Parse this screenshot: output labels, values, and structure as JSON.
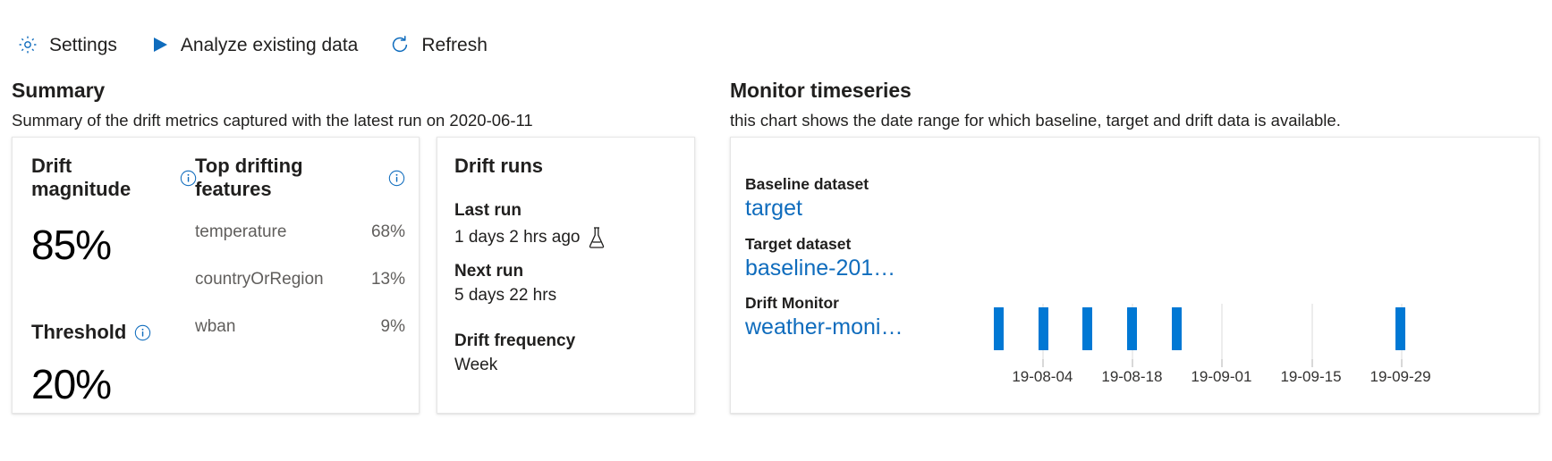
{
  "commandbar": {
    "buttons": [
      {
        "label": "Settings",
        "icon": "gear-icon"
      },
      {
        "label": "Analyze existing data",
        "icon": "play-icon"
      },
      {
        "label": "Refresh",
        "icon": "refresh-icon"
      }
    ]
  },
  "summary": {
    "title": "Summary",
    "subtitle": "Summary of the drift metrics captured with the latest run on 2020-06-11",
    "drift_magnitude": {
      "label": "Drift magnitude",
      "value": "85%",
      "info_icon": "info-icon"
    },
    "threshold": {
      "label": "Threshold",
      "value": "20%",
      "info_icon": "info-icon"
    },
    "top_drifting_features": {
      "label": "Top drifting features",
      "info_icon": "info-icon",
      "rows": [
        {
          "name": "temperature",
          "value": "68%"
        },
        {
          "name": "countryOrRegion",
          "value": "13%"
        },
        {
          "name": "wban",
          "value": "9%"
        }
      ]
    }
  },
  "drift_runs": {
    "title": "Drift runs",
    "last_run_label": "Last run",
    "last_run_value": "1 days 2 hrs ago",
    "last_run_icon": "flask-icon",
    "next_run_label": "Next run",
    "next_run_value": "5 days 22 hrs",
    "frequency_label": "Drift frequency",
    "frequency_value": "Week"
  },
  "monitor_timeseries": {
    "title": "Monitor timeseries",
    "subtitle": "this chart shows the date range for which baseline, target and drift data is available.",
    "baseline_label": "Baseline dataset",
    "baseline_link": "target",
    "target_label": "Target dataset",
    "target_link": "baseline-201…",
    "monitor_label": "Drift Monitor",
    "monitor_link": "weather-moni…",
    "link_color": "#0f6cbd",
    "bar_color": "#0078d4"
  },
  "chart_data": {
    "type": "bar",
    "title": "Monitor timeseries",
    "xlabel": "",
    "ylabel": "",
    "grid": true,
    "legend": false,
    "tick_labels": [
      "19-08-04",
      "19-08-18",
      "19-09-01",
      "19-09-15",
      "19-09-29"
    ],
    "tick_positions_pct": [
      21.5,
      36.0,
      50.5,
      65.0,
      79.5
    ],
    "series": [
      {
        "name": "Drift Monitor",
        "color": "#0078d4",
        "points": [
          {
            "x": "19-07-28",
            "x_pct": 14.4,
            "value": 1
          },
          {
            "x": "19-08-04",
            "x_pct": 21.6,
            "value": 1
          },
          {
            "x": "19-08-11",
            "x_pct": 28.8,
            "value": 1
          },
          {
            "x": "19-08-18",
            "x_pct": 36.0,
            "value": 1
          },
          {
            "x": "19-08-25",
            "x_pct": 43.2,
            "value": 1
          },
          {
            "x": "19-09-29",
            "x_pct": 79.5,
            "value": 1
          }
        ]
      }
    ]
  }
}
